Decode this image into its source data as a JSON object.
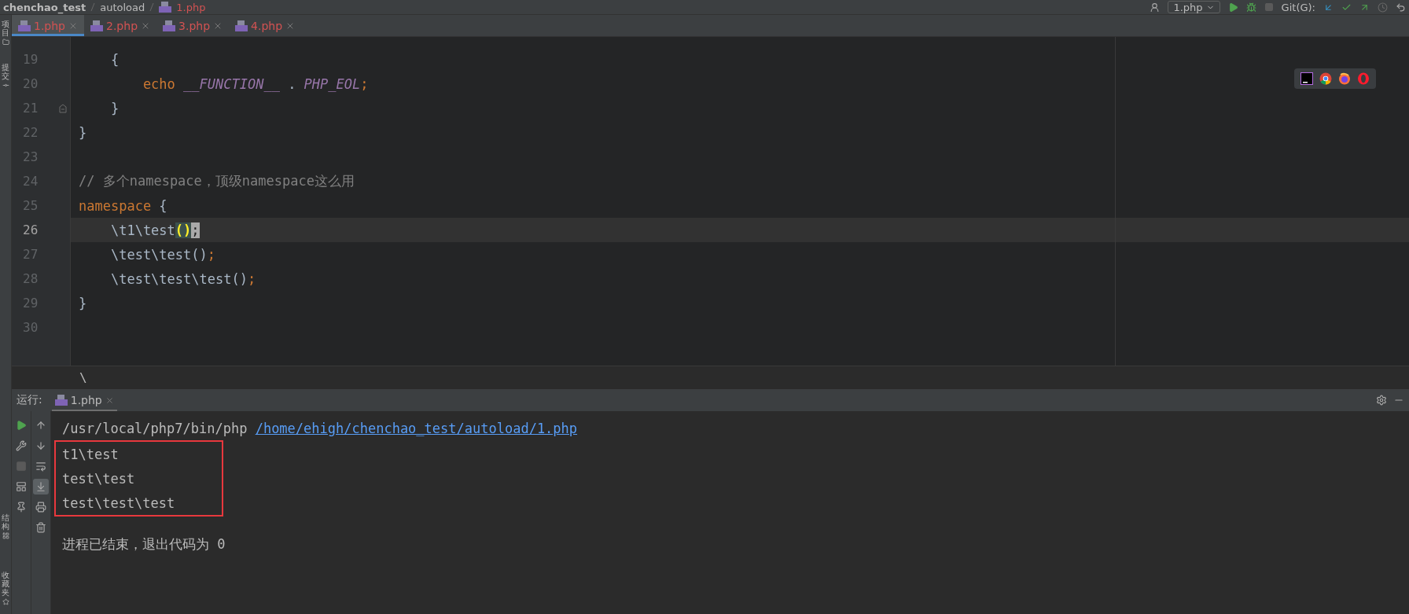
{
  "breadcrumb": [
    "chenchao_test",
    "autoload",
    "1.php"
  ],
  "toolbar": {
    "run_config": "1.php",
    "git_label": "Git(G):"
  },
  "tabs": [
    {
      "label": "1.php",
      "selected": true
    },
    {
      "label": "2.php",
      "selected": false
    },
    {
      "label": "3.php",
      "selected": false
    },
    {
      "label": "4.php",
      "selected": false
    }
  ],
  "editor": {
    "lines": [
      {
        "number": "19",
        "current": false,
        "fold": false,
        "tokens": [
          {
            "kind": "plain",
            "text": "    {"
          }
        ]
      },
      {
        "number": "20",
        "current": false,
        "fold": false,
        "tokens": [
          {
            "kind": "keyword",
            "text": "        echo "
          },
          {
            "kind": "constant",
            "text": "__FUNCTION__"
          },
          {
            "kind": "plain",
            "text": " . "
          },
          {
            "kind": "constant",
            "text": "PHP_EOL"
          },
          {
            "kind": "keyword",
            "text": ";"
          }
        ]
      },
      {
        "number": "21",
        "current": false,
        "fold": true,
        "tokens": [
          {
            "kind": "plain",
            "text": "    }"
          }
        ]
      },
      {
        "number": "22",
        "current": false,
        "fold": false,
        "tokens": [
          {
            "kind": "plain",
            "text": "}"
          }
        ]
      },
      {
        "number": "23",
        "current": false,
        "fold": false
      },
      {
        "number": "24",
        "current": false,
        "fold": false,
        "tokens": [
          {
            "kind": "comment",
            "text": "// 多个namespace，顶级namespace这么用"
          }
        ]
      },
      {
        "number": "25",
        "current": false,
        "fold": false,
        "tokens": [
          {
            "kind": "keyword",
            "text": "namespace"
          },
          {
            "kind": "plain",
            "text": " {"
          }
        ]
      },
      {
        "number": "26",
        "current": true,
        "fold": false,
        "tokens": [
          {
            "kind": "plain",
            "text": "    \\t1\\test"
          },
          {
            "kind": "match",
            "text": "()"
          },
          {
            "kind": "caret",
            "text": ";"
          }
        ]
      },
      {
        "number": "27",
        "current": false,
        "fold": false,
        "tokens": [
          {
            "kind": "plain",
            "text": "    \\test\\test()"
          },
          {
            "kind": "keyword",
            "text": ";"
          }
        ]
      },
      {
        "number": "28",
        "current": false,
        "fold": false,
        "tokens": [
          {
            "kind": "plain",
            "text": "    \\test\\test\\test()"
          },
          {
            "kind": "keyword",
            "text": ";"
          }
        ]
      },
      {
        "number": "29",
        "current": false,
        "fold": false,
        "tokens": [
          {
            "kind": "plain",
            "text": "}"
          }
        ]
      },
      {
        "number": "30",
        "current": false,
        "fold": false
      }
    ],
    "path_crumb": "\\"
  },
  "side_labels": [
    {
      "kind": "project",
      "text": "项目"
    },
    {
      "kind": "commit",
      "text": "提交"
    },
    {
      "kind": "structure",
      "text": "结构"
    },
    {
      "kind": "favorites",
      "text": "收藏夹"
    }
  ],
  "run_panel": {
    "label": "运行:",
    "tab": {
      "label": "1.php",
      "selected": true
    },
    "tools_left": [
      {
        "kind": "run"
      },
      {
        "kind": "wrench"
      },
      {
        "kind": "stop"
      },
      {
        "kind": "layout"
      },
      {
        "kind": "pin"
      }
    ],
    "tools_right": [
      {
        "kind": "up",
        "selected": false
      },
      {
        "kind": "down",
        "selected": false
      },
      {
        "kind": "wrap",
        "selected": false
      },
      {
        "kind": "scroll-end",
        "selected": true
      },
      {
        "kind": "print",
        "selected": false
      },
      {
        "kind": "trash",
        "selected": false
      }
    ],
    "command": "/usr/local/php7/bin/php",
    "script_link": "/home/ehigh/chenchao_test/autoload/1.php",
    "output": [
      "t1\\test",
      "test\\test",
      "test\\test\\test"
    ],
    "output_highlighted": true,
    "exit_message": "进程已结束，退出代码为 0"
  }
}
